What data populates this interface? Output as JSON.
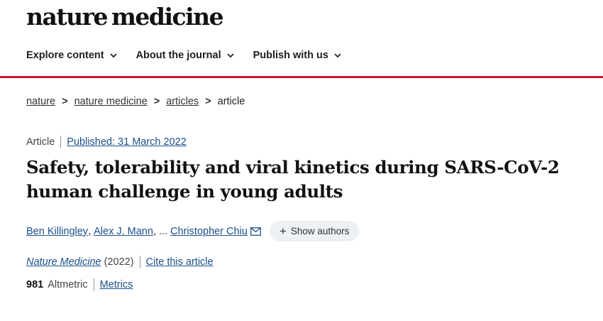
{
  "header": {
    "brand_word1": "nature",
    "brand_word2": "medicine",
    "nav": [
      {
        "label": "Explore content"
      },
      {
        "label": "About the journal"
      },
      {
        "label": "Publish with us"
      }
    ],
    "accent_color": "#c4162b"
  },
  "breadcrumb": {
    "items": [
      "nature",
      "nature medicine",
      "articles",
      "article"
    ],
    "separator": ">"
  },
  "article": {
    "type": "Article",
    "published": "Published: 31 March 2022",
    "title": "Safety, tolerability and viral kinetics during SARS-CoV-2 human challenge in young adults",
    "authors": {
      "first": "Ben Killingley",
      "second": "Alex J. Mann",
      "ellipsis": "...",
      "last": "Christopher Chiu",
      "show_authors_label": "Show authors",
      "plus": "+"
    },
    "journal": "Nature Medicine",
    "year": "(2022)",
    "cite_label": "Cite this article",
    "altmetric_count": "981",
    "altmetric_label": "Altmetric",
    "metrics_label": "Metrics",
    "link_color": "#1a4f8a"
  }
}
